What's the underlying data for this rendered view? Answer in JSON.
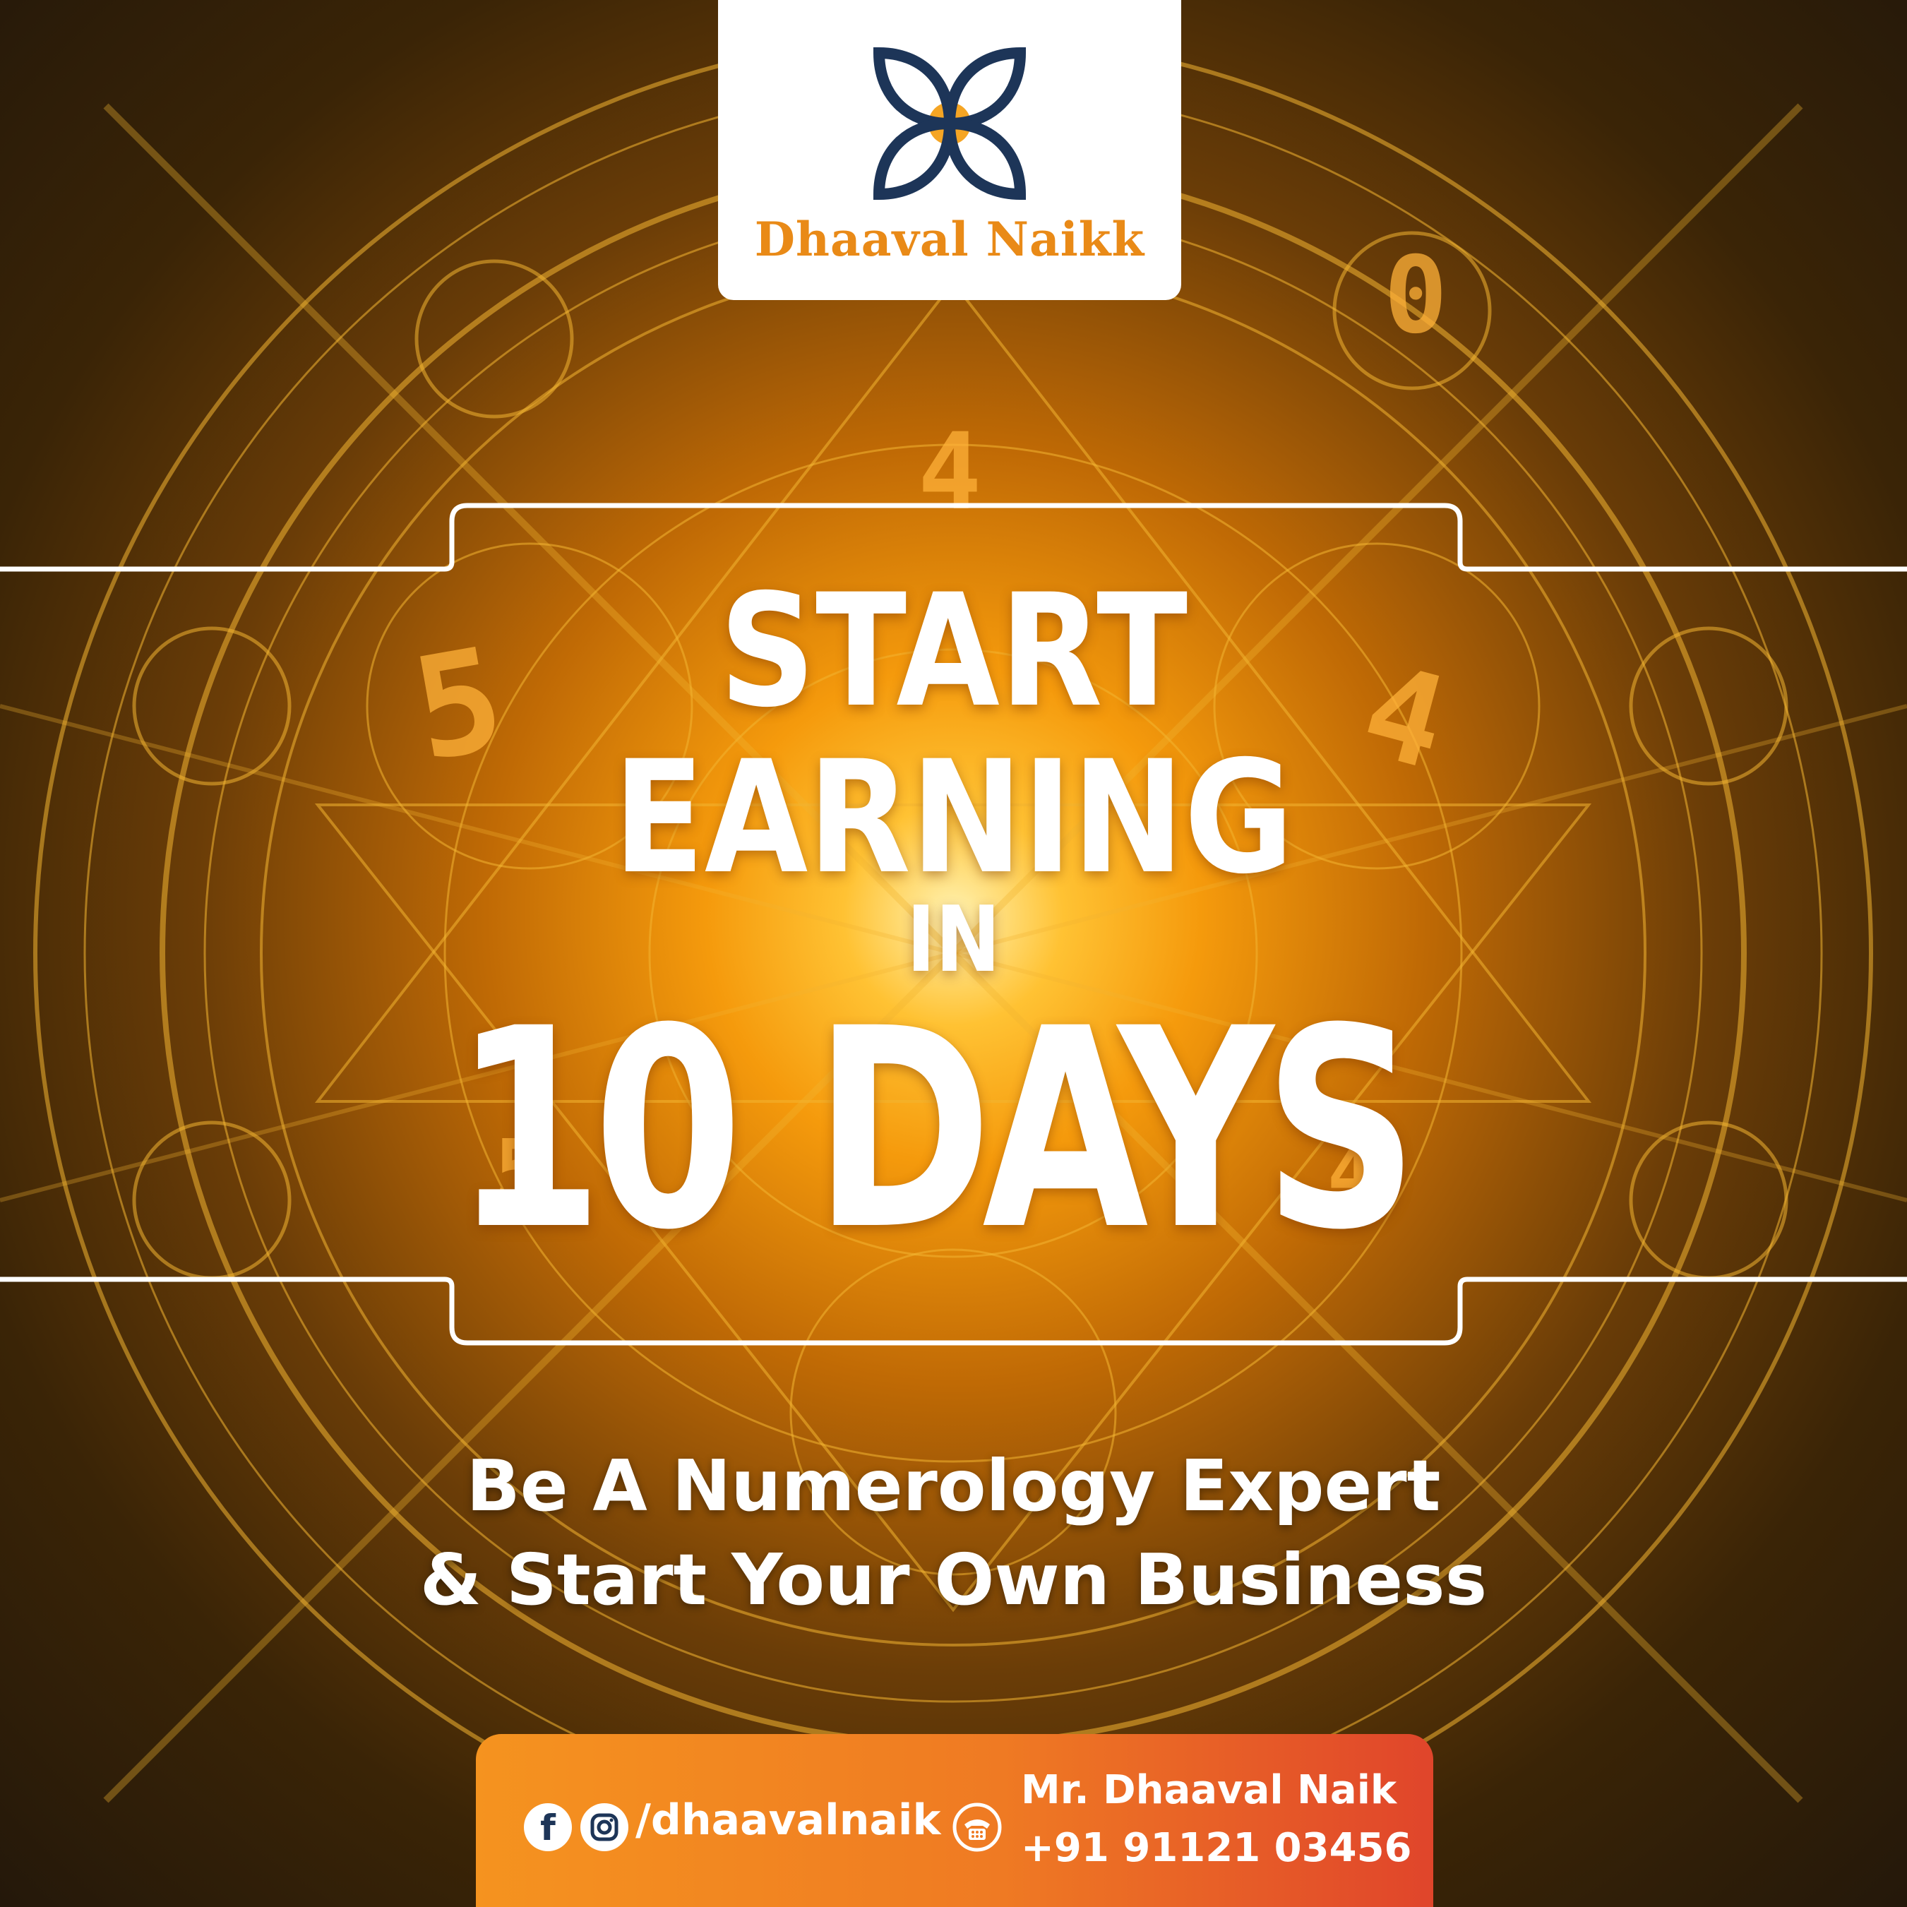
{
  "brand": {
    "name": "Dhaaval Naikk",
    "logo_icon": "four-petal-flower-icon"
  },
  "headline": {
    "line1": "START",
    "line2": "EARNING",
    "line3": "IN",
    "number": "10",
    "word": "DAYS"
  },
  "subtitle": {
    "line1": "Be A Numerology Expert",
    "line2": "& Start Your Own Business"
  },
  "contact": {
    "social_icons": [
      "facebook-icon",
      "instagram-icon"
    ],
    "social_handle": "/dhaavalnaik",
    "phone_icon": "telephone-icon",
    "name": "Mr. Dhaaval Naik",
    "phone": "+91 91121 03456"
  },
  "colors": {
    "brand_orange": "#e98a17",
    "logo_navy": "#1d3558",
    "bar_gradient_start": "#f5931f",
    "bar_gradient_end": "#e0452b"
  }
}
